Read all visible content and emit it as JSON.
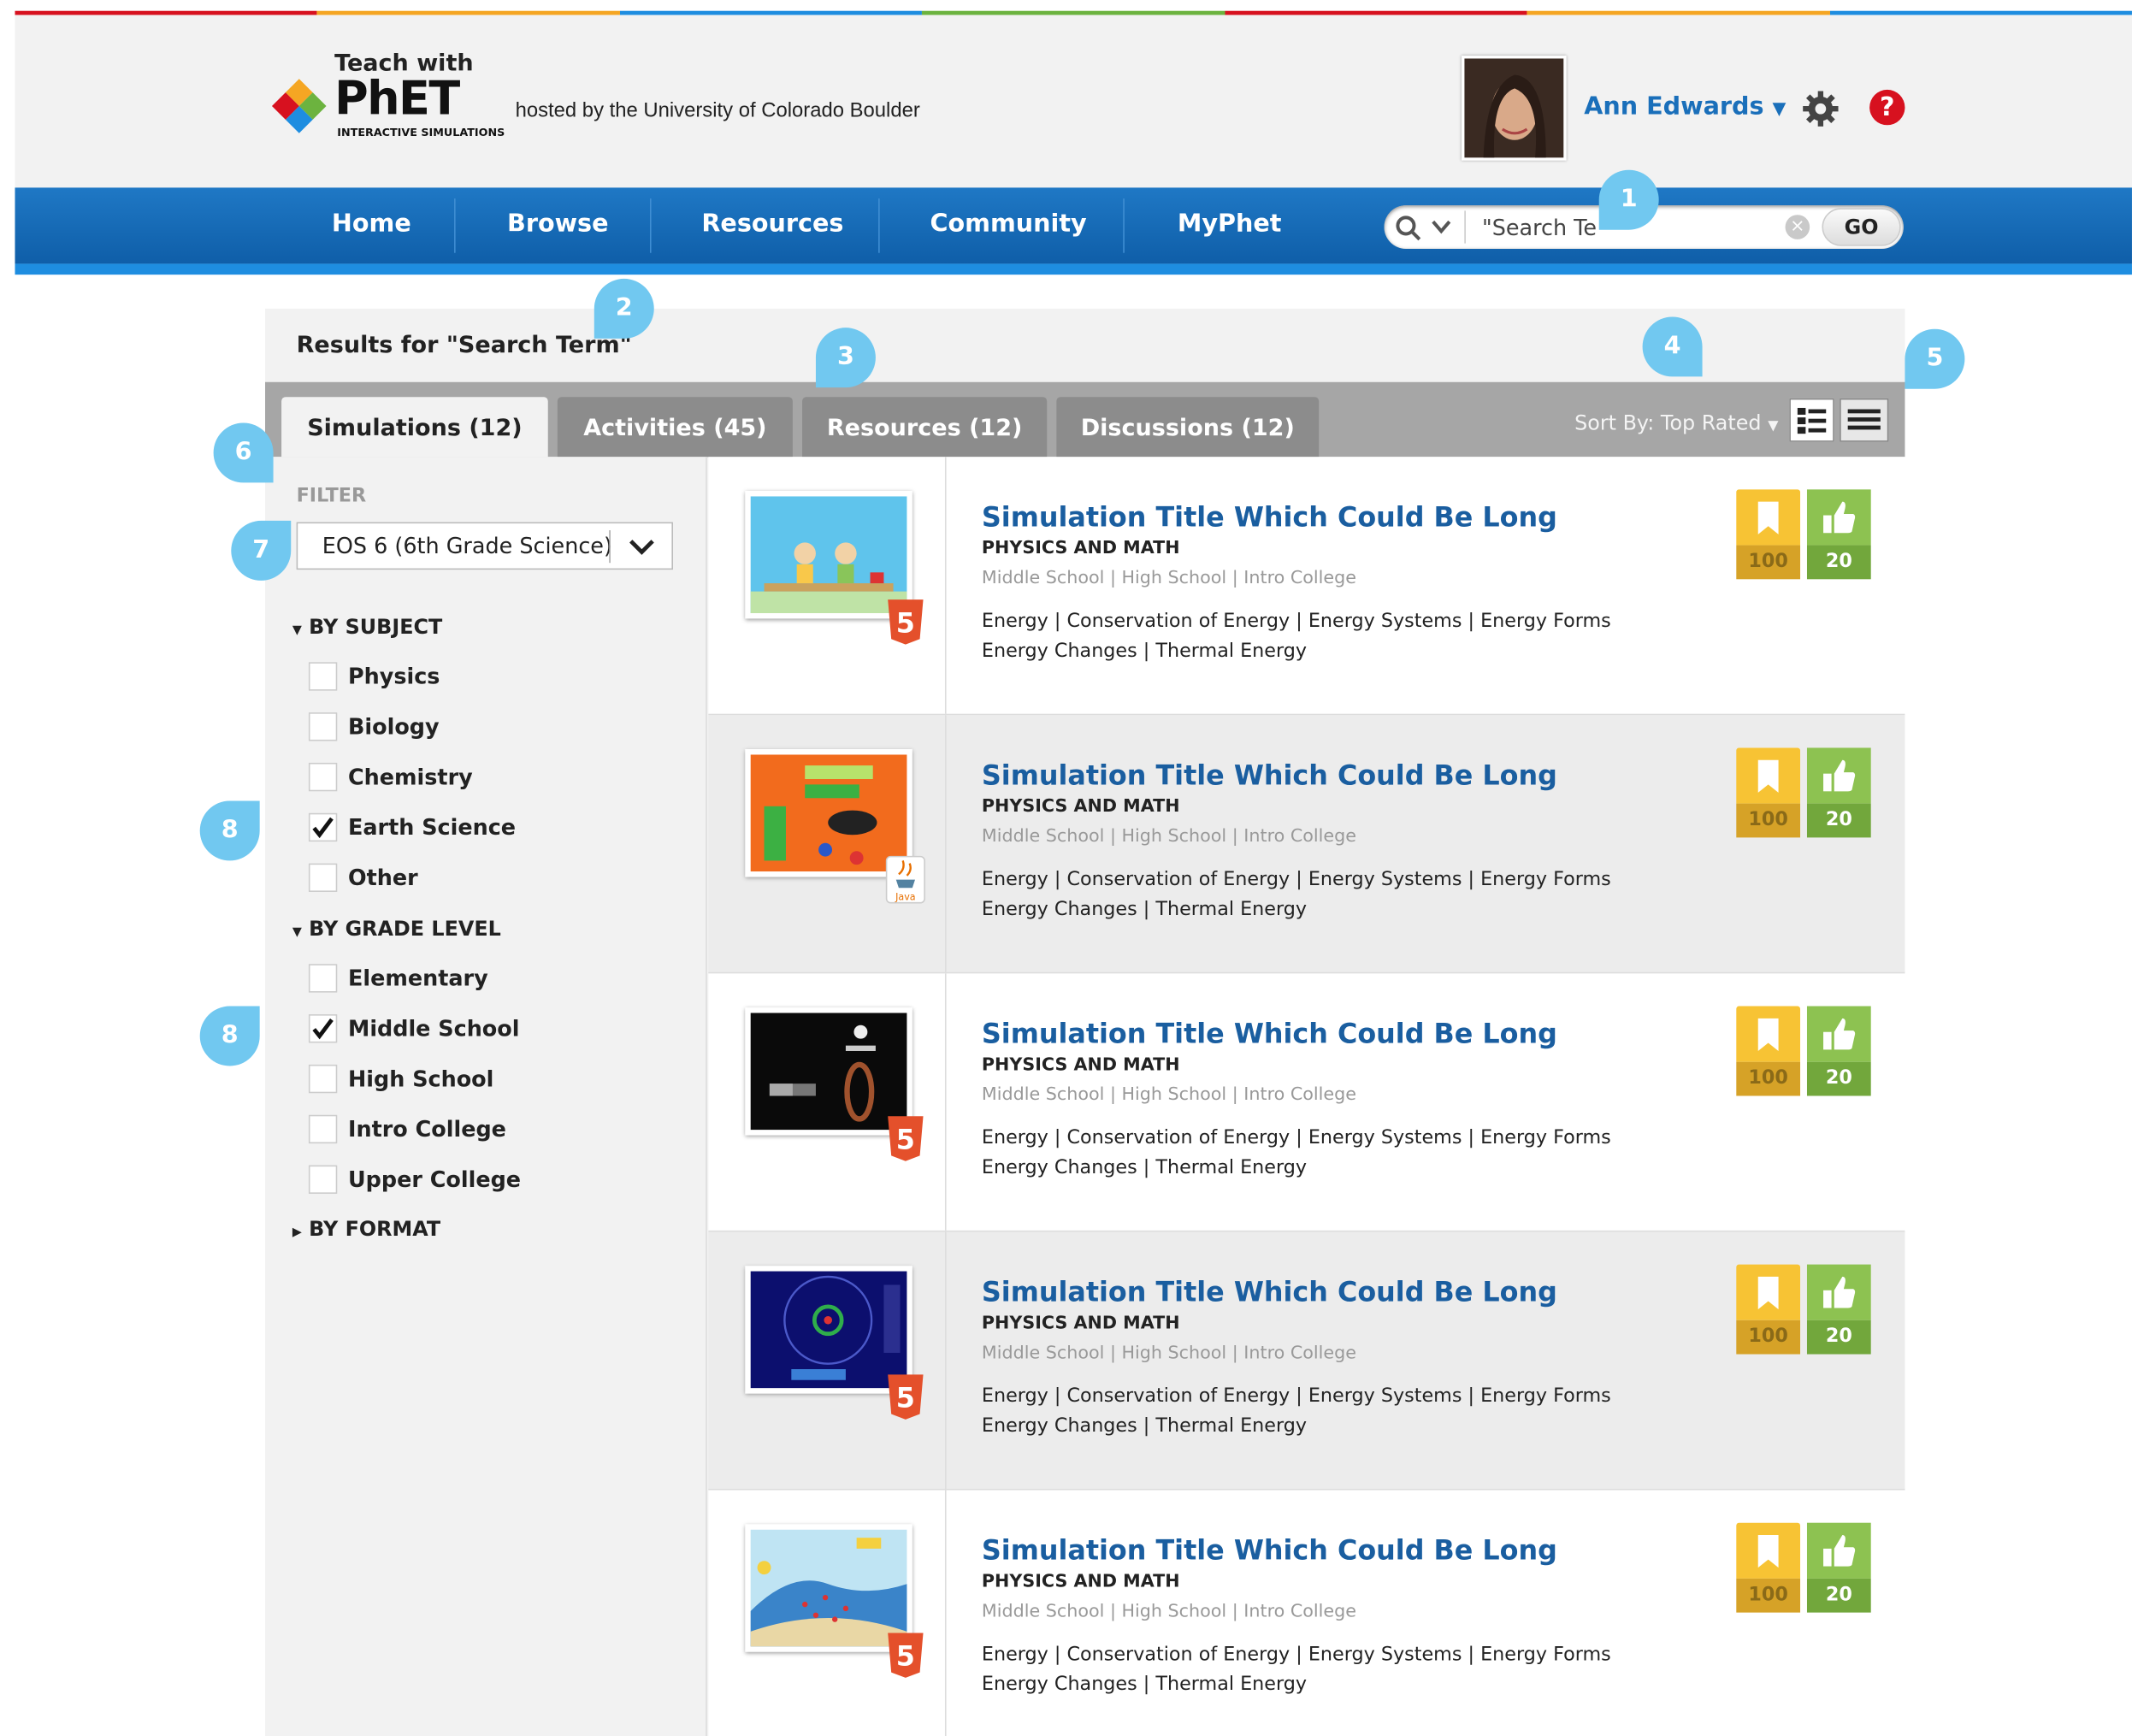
{
  "header": {
    "logo_teach": "Teach with",
    "logo_name": "PhET",
    "logo_sub": "INTERACTIVE SIMULATIONS",
    "hosted_text": "hosted by the University of Colorado Boulder",
    "user_name": "Ann Edwards",
    "help_label": "?"
  },
  "nav": {
    "items": [
      "Home",
      "Browse",
      "Resources",
      "Community",
      "MyPhet"
    ]
  },
  "search": {
    "value": "\"Search Te",
    "go_label": "GO"
  },
  "results": {
    "title": "Results for \"Search Term\""
  },
  "tabs": [
    {
      "label": "Simulations (12)"
    },
    {
      "label": "Activities (45)"
    },
    {
      "label": "Resources (12)"
    },
    {
      "label": "Discussions (12)"
    }
  ],
  "sort": {
    "label": "Sort By: Top Rated"
  },
  "filter": {
    "label": "FILTER",
    "selected": "EOS 6 (6th Grade Science)",
    "subject_heading": "BY SUBJECT",
    "subjects": [
      {
        "label": "Physics",
        "checked": false
      },
      {
        "label": "Biology",
        "checked": false
      },
      {
        "label": "Chemistry",
        "checked": false
      },
      {
        "label": "Earth Science",
        "checked": true
      },
      {
        "label": "Other",
        "checked": false
      }
    ],
    "grade_heading": "BY GRADE LEVEL",
    "grades": [
      {
        "label": "Elementary",
        "checked": false
      },
      {
        "label": "Middle School",
        "checked": true
      },
      {
        "label": "High School",
        "checked": false
      },
      {
        "label": "Intro College",
        "checked": false
      },
      {
        "label": "Upper College",
        "checked": false
      }
    ],
    "format_heading": "BY FORMAT"
  },
  "simulations": [
    {
      "title": "Simulation Title Which Could Be Long",
      "category": "PHYSICS AND MATH",
      "levels": "Middle School  |  High School  |  Intro College",
      "tags1": "Energy  |  Conservation of Energy  |  Energy Systems  |  Energy Forms",
      "tags2": "Energy Changes  |  Thermal Energy",
      "favorites": "100",
      "likes": "20",
      "format": "html5"
    },
    {
      "title": "Simulation Title Which Could Be Long",
      "category": "PHYSICS AND MATH",
      "levels": "Middle School  |  High School  |  Intro College",
      "tags1": "Energy  |  Conservation of Energy  |  Energy Systems  |  Energy Forms",
      "tags2": "Energy Changes  |  Thermal Energy",
      "favorites": "100",
      "likes": "20",
      "format": "java"
    },
    {
      "title": "Simulation Title Which Could Be Long",
      "category": "PHYSICS AND MATH",
      "levels": "Middle School  |  High School  |  Intro College",
      "tags1": "Energy  |  Conservation of Energy  |  Energy Systems  |  Energy Forms",
      "tags2": "Energy Changes  |  Thermal Energy",
      "favorites": "100",
      "likes": "20",
      "format": "html5"
    },
    {
      "title": "Simulation Title Which Could Be Long",
      "category": "PHYSICS AND MATH",
      "levels": "Middle School  |  High School  |  Intro College",
      "tags1": "Energy  |  Conservation of Energy  |  Energy Systems  |  Energy Forms",
      "tags2": "Energy Changes  |  Thermal Energy",
      "favorites": "100",
      "likes": "20",
      "format": "html5"
    },
    {
      "title": "Simulation Title Which Could Be Long",
      "category": "PHYSICS AND MATH",
      "levels": "Middle School  |  High School  |  Intro College",
      "tags1": "Energy  |  Conservation of Energy  |  Energy Systems  |  Energy Forms",
      "tags2": "Energy Changes  |  Thermal Energy",
      "favorites": "100",
      "likes": "20",
      "format": "html5"
    }
  ],
  "java_label": "Java",
  "callouts": [
    "1",
    "2",
    "3",
    "4",
    "5",
    "6",
    "7",
    "8",
    "8"
  ],
  "colors": {
    "nav_blue": "#0f5ea8",
    "link_blue": "#1a5ea0",
    "favorite_yellow": "#f7c334",
    "like_green": "#8dc251",
    "callout_blue": "#71c8f0",
    "stripe": [
      "#d7111f",
      "#f5a623",
      "#1e8de0",
      "#6cb33f",
      "#d7111f",
      "#f5a623",
      "#1e8de0"
    ]
  }
}
